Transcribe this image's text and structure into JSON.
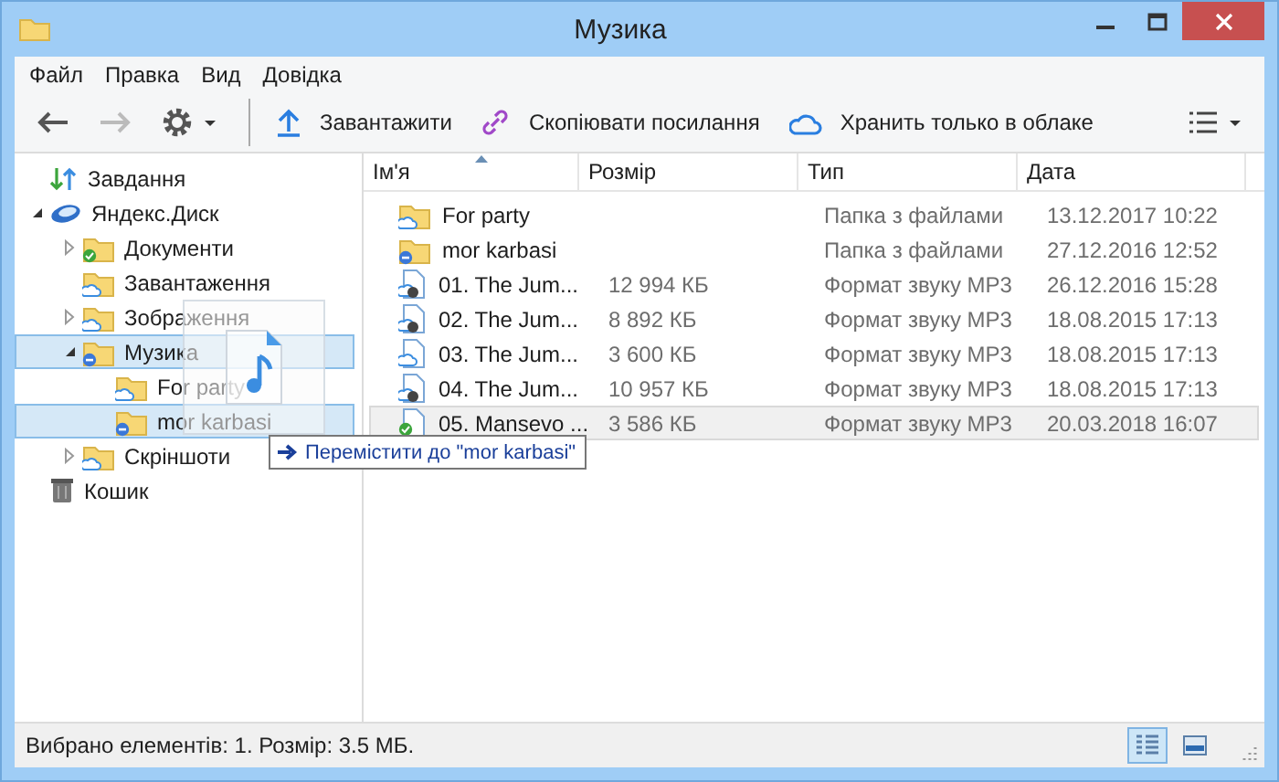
{
  "window": {
    "title": "Музика"
  },
  "menu": [
    "Файл",
    "Правка",
    "Вид",
    "Довідка"
  ],
  "toolbar": [
    {
      "kind": "back",
      "disabled": false
    },
    {
      "kind": "forward",
      "disabled": true
    },
    {
      "kind": "settings",
      "disabled": false
    },
    {
      "kind": "upload",
      "label": "Завантажити"
    },
    {
      "kind": "link",
      "label": "Скопіювати посилання"
    },
    {
      "kind": "cloud",
      "label": "Хранить только в облаке"
    }
  ],
  "tree": [
    {
      "label": "Завдання",
      "kind": "tasks",
      "selected": false
    },
    {
      "label": "Яндекс.Диск",
      "kind": "disk",
      "selected": false,
      "expanded": true,
      "children": [
        {
          "label": "Документи",
          "kind": "synced_folder",
          "selected": false,
          "expanded": false
        },
        {
          "label": "Завантаження",
          "kind": "cloud_folder",
          "selected": false
        },
        {
          "label": "Зображення",
          "kind": "cloud_folder",
          "selected": false,
          "expanded": false
        },
        {
          "label": "Музика",
          "kind": "local_folder",
          "selected": true,
          "expanded": true,
          "children": [
            {
              "label": "For party",
              "kind": "cloud_folder",
              "selected": false
            },
            {
              "label": "mor karbasi",
              "kind": "local_folder",
              "selected": true
            }
          ]
        },
        {
          "label": "Скріншоти",
          "kind": "cloud_folder",
          "selected": false,
          "expanded": false
        }
      ]
    },
    {
      "label": "Кошик",
      "kind": "trash",
      "selected": false
    }
  ],
  "table": {
    "columns": [
      "Ім'я",
      "Розмір",
      "Тип",
      "Дата"
    ],
    "rows": [
      {
        "kind": "cloud_folder",
        "name": "For party",
        "type": "Папка з файлами",
        "date": "13.12.2017 10:22",
        "selected": false
      },
      {
        "kind": "local_folder",
        "name": "mor karbasi",
        "type": "Папка з файлами",
        "date": "27.12.2016 12:52",
        "selected": false
      },
      {
        "kind": "downloading_audio",
        "name": "01. The Jum...",
        "size": "12 994 КБ",
        "type": "Формат звуку MP3",
        "date": "26.12.2016 15:28",
        "selected": false
      },
      {
        "kind": "downloading_audio",
        "name": "02. The Jum...",
        "size": "8 892 КБ",
        "type": "Формат звуку MP3",
        "date": "18.08.2015 17:13",
        "selected": false
      },
      {
        "kind": "cloud_audio",
        "name": "03. The Jum...",
        "size": "3 600 КБ",
        "type": "Формат звуку MP3",
        "date": "18.08.2015 17:13",
        "selected": false
      },
      {
        "kind": "downloading_audio",
        "name": "04. The Jum...",
        "size": "10 957 КБ",
        "type": "Формат звуку MP3",
        "date": "18.08.2015 17:13",
        "selected": false
      },
      {
        "kind": "synced_audio",
        "name": "05. Mansevo ...",
        "size": "3 586 КБ",
        "type": "Формат звуку MP3",
        "date": "20.03.2018 16:07",
        "selected": true
      }
    ]
  },
  "drag": {
    "tooltip": "Перемістити до \"mor karbasi\""
  },
  "status_bar": {
    "text": "Вибрано елементів: 1. Розмір: 3.5 МБ.",
    "views": [
      {
        "kind": "details",
        "selected": true
      },
      {
        "kind": "tiles",
        "selected": false
      }
    ]
  }
}
